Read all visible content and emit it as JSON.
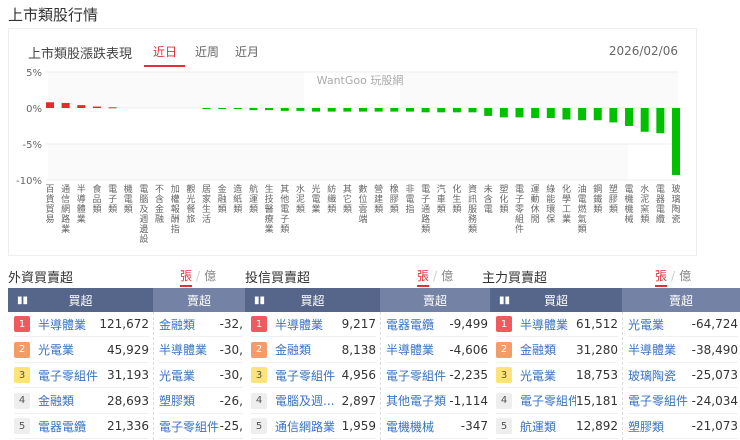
{
  "page_title": "上市類股行情",
  "card": {
    "title": "上市類股漲跌表現",
    "tabs": [
      "近日",
      "近周",
      "近月"
    ],
    "active_tab": 0,
    "date": "2026/02/06",
    "watermark": "WantGoo 玩股網"
  },
  "chart_data": {
    "type": "bar",
    "ylim": [
      -10,
      5
    ],
    "yticks": [
      "5%",
      "0%",
      "-5%",
      "-10%"
    ],
    "ytick_values": [
      5,
      0,
      -5,
      -10
    ],
    "categories": [
      "百貨貿易",
      "通信網路業",
      "半導體業",
      "食品類",
      "電子類",
      "機電類",
      "電腦及週邊設",
      "不含金融",
      "加權報酬指",
      "觀光餐旅",
      "居家生活",
      "金融類",
      "造紙類",
      "航運類",
      "生技醫療業",
      "其他電子類",
      "水泥類",
      "光電業",
      "紡織類",
      "其它類",
      "數位雲端",
      "營建類",
      "橡膠類",
      "非電指",
      "電子通路類",
      "汽車類",
      "化生類",
      "資訊服務類",
      "未含電",
      "塑化類",
      "電子零組件",
      "運動休閒",
      "綠能環保",
      "化學工業",
      "油電燃氣類",
      "鋼鐵類",
      "塑膠類",
      "電機機械",
      "水泥窯類",
      "電器電纜",
      "玻璃陶瓷"
    ],
    "values": [
      0.8,
      0.7,
      0.4,
      0.2,
      0.1,
      0,
      0,
      0,
      0,
      0,
      -0.05,
      -0.05,
      -0.1,
      -0.3,
      -0.3,
      -0.4,
      -0.4,
      -0.5,
      -0.5,
      -0.5,
      -0.5,
      -0.5,
      -0.5,
      -0.5,
      -0.6,
      -0.6,
      -0.6,
      -0.6,
      -1.1,
      -1.3,
      -1.3,
      -1.4,
      -1.4,
      -1.6,
      -1.7,
      -1.7,
      -2.0,
      -2.5,
      -3.3,
      -3.5,
      -9.3
    ],
    "colors": {
      "up": "#e32b2b",
      "down": "#00c000"
    }
  },
  "sections": [
    {
      "title": "外資買賣超",
      "unit_on": "張",
      "unit_off": "億",
      "buy_label": "買超",
      "sell_label": "賣超",
      "buy": [
        [
          "半導體業",
          "121,672"
        ],
        [
          "光電業",
          "45,929"
        ],
        [
          "電子零組件",
          "31,193"
        ],
        [
          "金融類",
          "28,693"
        ],
        [
          "電器電纜",
          "21,336"
        ]
      ],
      "sell": [
        [
          "金融類",
          "-32,"
        ],
        [
          "半導體業",
          "-30,"
        ],
        [
          "光電業",
          "-30,"
        ],
        [
          "塑膠類",
          "-26,"
        ],
        [
          "電子零組件",
          "-25,"
        ]
      ]
    },
    {
      "title": "投信買賣超",
      "unit_on": "張",
      "unit_off": "億",
      "buy_label": "買超",
      "sell_label": "賣超",
      "buy": [
        [
          "半導體業",
          "9,217"
        ],
        [
          "金融類",
          "8,138"
        ],
        [
          "電子零組件",
          "4,956"
        ],
        [
          "電腦及週...",
          "2,897"
        ],
        [
          "通信網路業",
          "1,959"
        ]
      ],
      "sell": [
        [
          "電器電纜",
          "-9,499"
        ],
        [
          "半導體業",
          "-4,606"
        ],
        [
          "電子零組件",
          "-2,235"
        ],
        [
          "其他電子類",
          "-1,114"
        ],
        [
          "電機機械",
          "-347"
        ]
      ]
    },
    {
      "title": "主力買賣超",
      "unit_on": "張",
      "unit_off": "億",
      "buy_label": "買超",
      "sell_label": "賣超",
      "buy": [
        [
          "半導體業",
          "61,512"
        ],
        [
          "金融類",
          "31,280"
        ],
        [
          "光電業",
          "18,753"
        ],
        [
          "電子零組件",
          "15,181"
        ],
        [
          "航運類",
          "12,892"
        ]
      ],
      "sell": [
        [
          "光電業",
          "-64,724"
        ],
        [
          "半導體業",
          "-38,490"
        ],
        [
          "玻璃陶瓷",
          "-25,073"
        ],
        [
          "電子零組件",
          "-24,034"
        ],
        [
          "塑膠類",
          "-21,073"
        ]
      ]
    }
  ]
}
